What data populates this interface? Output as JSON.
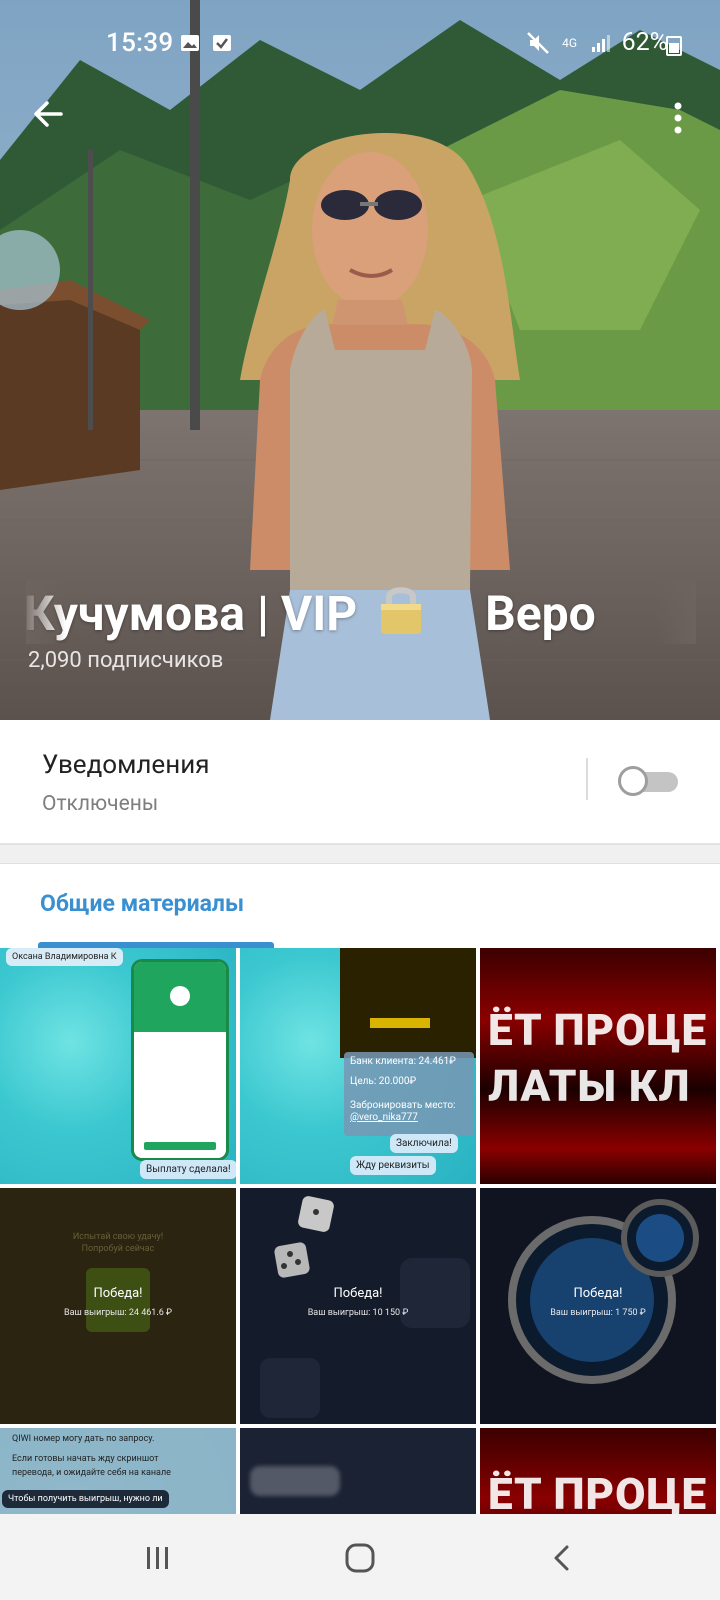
{
  "status_bar": {
    "time": "15:39",
    "battery_percent": "62%",
    "network": "4G"
  },
  "channel": {
    "title": "а Кучумова | VIP",
    "title_continuation": "Веро",
    "subscribers": "2,090 подписчиков"
  },
  "notifications": {
    "label": "Уведомления",
    "status": "Отключены",
    "enabled": false
  },
  "tabs": {
    "active": "Общие материалы"
  },
  "media": {
    "cell1": {
      "header": "Оксана Владимировна К",
      "caption": "Выплату сделала!"
    },
    "cell2": {
      "line1": "Банк клиента: 24.461₽",
      "line2": "Цель: 20.000₽",
      "line3": "Забронировать место:",
      "line4": "@vero_nika777",
      "line5": "Заключила!",
      "line6": "Жду реквизиты"
    },
    "cell3": {
      "text1": "ЁТ ПРОЦЕ",
      "text2": "ЛАТЫ КЛ"
    },
    "cell4": {
      "top1": "Испытай свою удачу!",
      "top2": "Попробуй сейчас",
      "title": "Победа!",
      "sub": "Ваш выигрыш: 24 461.6 ₽"
    },
    "cell5": {
      "title": "Победа!",
      "sub": "Ваш выигрыш: 10 150 ₽"
    },
    "cell6": {
      "title": "Победа!",
      "sub": "Ваш выигрыш: 1 750 ₽"
    },
    "cell7": {
      "line1": "QIWI номер могу дать по запросу.",
      "line2": "Если готовы начать жду скриншот",
      "line3": "перевода, и ожидайте себя на канале",
      "line4": "Чтобы получить выигрыш, нужно ли"
    },
    "cell9": {
      "text1": "ЁТ ПРОЦЕ"
    }
  },
  "colors": {
    "accent": "#3a8fd1",
    "toggle_off": "#c4c4c4"
  }
}
